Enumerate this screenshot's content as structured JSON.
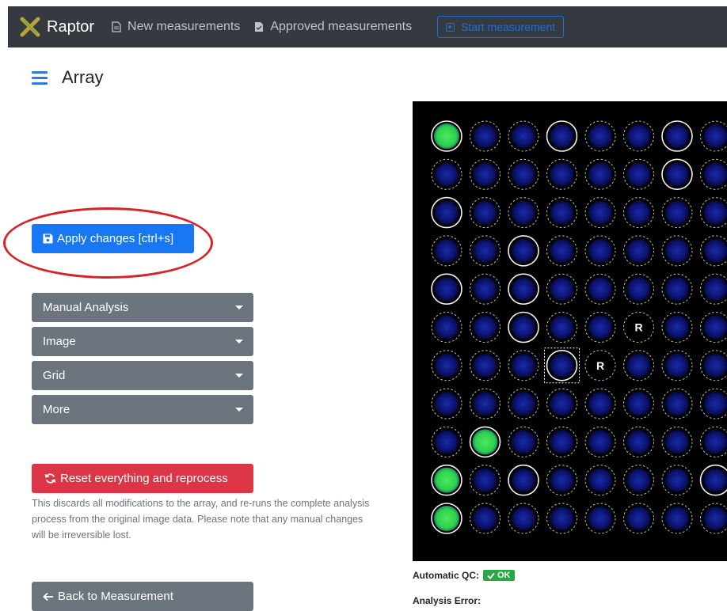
{
  "navbar": {
    "brand": "Raptor",
    "links": [
      "New measurements",
      "Approved measurements"
    ],
    "start_button": "Start measurement"
  },
  "page": {
    "title": "Array"
  },
  "toolbar": {
    "apply_label": "Apply changes [ctrl+s]",
    "menus": [
      "Manual Analysis",
      "Image",
      "Grid",
      "More"
    ],
    "reset_label": "Reset everything and reprocess",
    "reset_description": "This discards all modifications to the array, and re-runs the complete analysis process from the original image data. Please note that any manual changes will be irreversible lost.",
    "back_label": "Back to Measurement"
  },
  "array": {
    "rows": 11,
    "cols": 8,
    "marker_label": "R",
    "marked_spots": [
      [
        5,
        5
      ],
      [
        6,
        4
      ]
    ],
    "bright_spots": [
      [
        0,
        0
      ],
      [
        8,
        1
      ],
      [
        9,
        0
      ],
      [
        10,
        0
      ]
    ],
    "solid_spots": [
      [
        0,
        0
      ],
      [
        0,
        3
      ],
      [
        0,
        6
      ],
      [
        1,
        6
      ],
      [
        2,
        0
      ],
      [
        3,
        2
      ],
      [
        4,
        0
      ],
      [
        4,
        2
      ],
      [
        5,
        2
      ],
      [
        6,
        3
      ],
      [
        8,
        1
      ],
      [
        9,
        0
      ],
      [
        9,
        2
      ],
      [
        9,
        7
      ],
      [
        10,
        0
      ]
    ],
    "selected_spot": [
      6,
      3
    ],
    "colors": {
      "background": "#000000",
      "spot": "#0c1470",
      "bright_spot": "#2fd14b",
      "outline": "#ffffff"
    }
  },
  "qc": {
    "label": "Automatic QC:",
    "status": "OK",
    "error_label": "Analysis Error:"
  },
  "colors": {
    "navbar": "#343a40",
    "primary": "#1877f2",
    "secondary": "#6c757d",
    "danger": "#dc3545",
    "success": "#28a745",
    "highlight": "#d8232a"
  }
}
